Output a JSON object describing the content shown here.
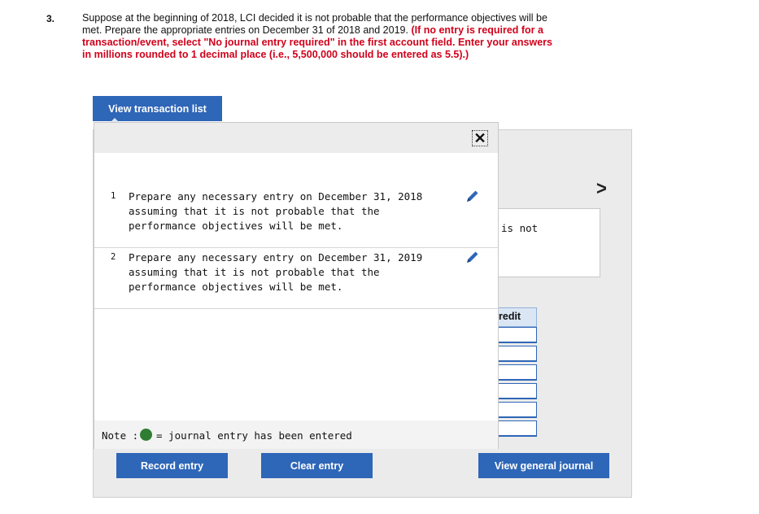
{
  "question": {
    "number": "3.",
    "text": "Suppose at the beginning of 2018, LCI decided it is not probable that the performance objectives will be met. Prepare the appropriate entries on December 31 of 2018 and 2019.",
    "instruction": "(If no entry is required for a transaction/event, select \"No journal entry required\" in the first account field. Enter your answers in millions rounded to 1 decimal place (i.e., 5,500,000 should be entered as 5.5).)"
  },
  "view_list_label": "View transaction list",
  "popup": {
    "close_glyph": "✕",
    "transactions": [
      {
        "num": "1",
        "text": "Prepare any necessary entry on December 31, 2018 assuming that it is not probable that the performance objectives will be met."
      },
      {
        "num": "2",
        "text": "Prepare any necessary entry on December 31, 2019 assuming that it is not probable that the performance objectives will be met."
      }
    ],
    "note": {
      "label": "Note :",
      "text": "= journal entry has been entered",
      "dot_color": "#2f7d33"
    }
  },
  "background": {
    "next_arrow": ">",
    "desc_fragment": "is not",
    "credit_header": "redit"
  },
  "buttons": {
    "record": "Record entry",
    "clear": "Clear entry",
    "view_journal": "View general journal"
  },
  "colors": {
    "primary": "#2e66b8",
    "instruction_red": "#d0021b"
  },
  "icons": {
    "edit": "pencil-icon",
    "close": "close-icon",
    "next": "chevron-right-icon"
  }
}
